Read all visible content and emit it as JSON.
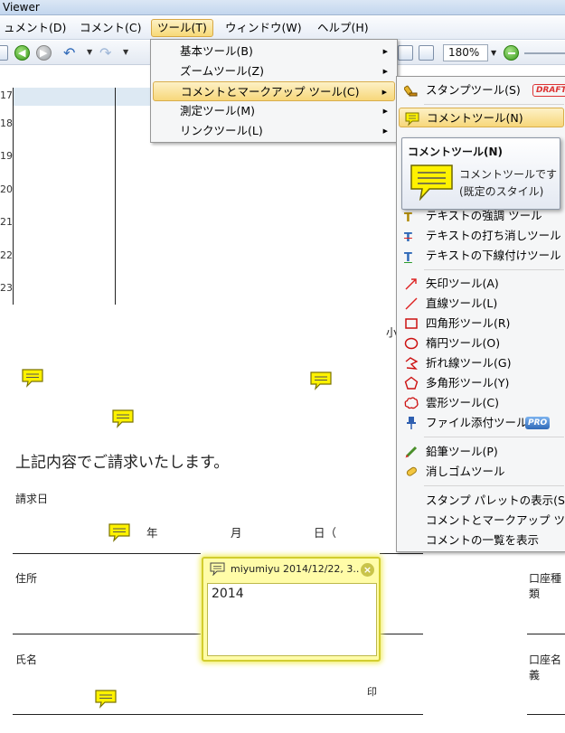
{
  "window": {
    "title": "Viewer"
  },
  "menubar": {
    "items": [
      "ュメント(D)",
      "コメント(C)",
      "ツール(T)",
      "ウィンドウ(W)",
      "ヘルプ(H)"
    ]
  },
  "toolbar": {
    "zoom": "180%"
  },
  "tools_menu": {
    "items": [
      "基本ツール(B)",
      "ズームツール(Z)",
      "コメントとマークアップ ツール(C)",
      "測定ツール(M)",
      "リンクツール(L)"
    ]
  },
  "comment_menu": {
    "stamp_tool": "スタンプツール(S)",
    "stamp_badge": "DRAFT",
    "note_tool": "コメントツール(N)",
    "highlight_tool": "テキストの強調 ツール",
    "strikeout_tool": "テキストの打ち消しツール",
    "underline_tool": "テキストの下線付けツール",
    "arrow_tool": "矢印ツール(A)",
    "line_tool": "直線ツール(L)",
    "rectangle_tool": "四角形ツール(R)",
    "oval_tool": "楕円ツール(O)",
    "polyline_tool": "折れ線ツール(G)",
    "polygon_tool": "多角形ツール(Y)",
    "cloud_tool": "雲形ツール(C)",
    "attach_tool": "ファイル添付ツール",
    "pro_badge": "PRO",
    "pencil_tool": "鉛筆ツール(P)",
    "eraser_tool": "消しゴムツール",
    "show_stamp_palette": "スタンプ パレットの表示(S)",
    "comment_markup_toolbar": "コメントとマークアップ ツー",
    "show_comment_list": "コメントの一覧を表示"
  },
  "tooltip": {
    "title": "コメントツール(N)",
    "line1": "コメントツールです",
    "line2": "(既定のスタイル)"
  },
  "document": {
    "row_numbers": [
      "17",
      "18",
      "19",
      "20",
      "21",
      "22",
      "23"
    ],
    "small_char": "小",
    "statement": "上記内容でご請求いたします。",
    "invoice_date_label": "請求日",
    "year": "年",
    "month": "月",
    "day": "日（",
    "address_label": "住所",
    "account_type_label": "口座種類",
    "name_label": "氏名",
    "account_name_label": "口座名義",
    "seal": "印"
  },
  "popup_note": {
    "author": "miyumiyu 2014/12/22, 3..",
    "close": "×",
    "content": "2014"
  },
  "colors": {
    "note_yellow": "#fff200",
    "menu_highlight": "#f7d77a",
    "accent_blue": "#2f69b8"
  }
}
